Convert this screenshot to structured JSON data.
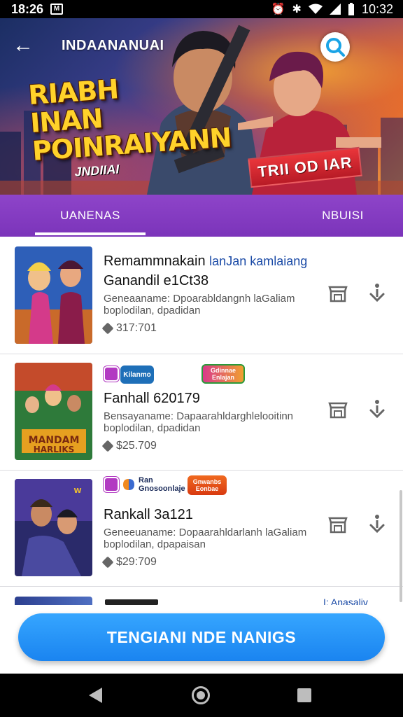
{
  "status_bar": {
    "time": "18:26",
    "right_time": "10:32",
    "notif_badge": "M",
    "icons": [
      "alarm-icon",
      "bluetooth-icon",
      "wifi-icon",
      "signal-icon",
      "battery-icon"
    ]
  },
  "header": {
    "title": "INDAANANUAI",
    "back_icon": "arrow-left-icon",
    "search_icon": "search-icon"
  },
  "hero": {
    "logo_line1": "RIABH INAN",
    "logo_line2": "POINRAIYANN",
    "logo_line3": "JNDIIAI",
    "cta_label": "TRII OD IAR"
  },
  "tabs": [
    {
      "label": "UANENAS",
      "active": true
    },
    {
      "label": "NBUISI",
      "active": false
    }
  ],
  "items": [
    {
      "title_main": "Remammnakain",
      "title_highlight": "lanJan kamlaiang",
      "title_line2": "Ganandil e1Ct38",
      "description": "Geneaaname: Dpoarabldangnh laGaliam boplodilan, dpadidan",
      "price": "317:701",
      "badges": []
    },
    {
      "title_main": "Fanhall 620179",
      "title_highlight": "",
      "title_line2": "",
      "description": "Bensayaname: Dapaarahldarghlelooitinn boplodilan, dpadidan",
      "price": "$25.709",
      "badges": [
        "Kilanmo",
        "Gdinnae Enlajan"
      ]
    },
    {
      "title_main": "Rankall 3a121",
      "title_highlight": "",
      "title_line2": "",
      "description": "Geneeuaname: Dopaarahldarlanh laGaliam boplodilan, dpapaisan",
      "price": "$29:709",
      "badges": [
        "Ran Gnosoonlaje",
        "Gnwanbs Eonbae"
      ]
    }
  ],
  "partial_row": {
    "text": "I: Anasaliv"
  },
  "bottom_button": {
    "label": "TENGIANI NDE NANIGS"
  },
  "colors": {
    "tab_bar": "#8e44c9",
    "cta_blue": "#1a84f0",
    "title_highlight": "#1a4aa6"
  }
}
